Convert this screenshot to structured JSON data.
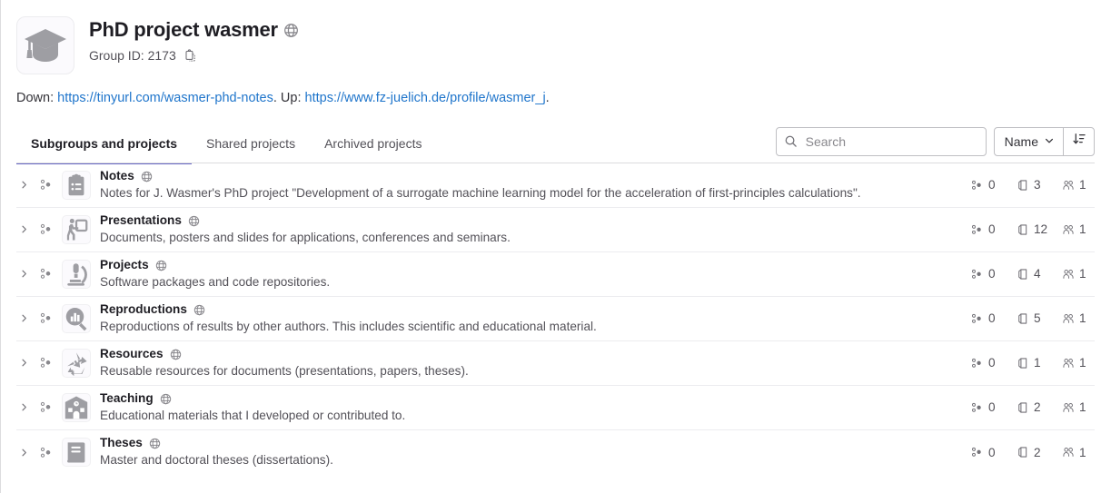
{
  "header": {
    "avatar_icon": "graduation-cap-icon",
    "title": "PhD project wasmer",
    "visibility_icon": "globe-icon",
    "group_id_label": "Group ID: 2173",
    "copy_icon": "clipboard-copy-icon"
  },
  "description": {
    "prefix": "Down: ",
    "link1_text": "https://tinyurl.com/wasmer-phd-notes",
    "middle": ". Up: ",
    "link2_text": "https://www.fz-juelich.de/profile/wasmer_j",
    "suffix": ".",
    "link_color": "#1f75cb"
  },
  "tabs": [
    {
      "label": "Subgroups and projects",
      "active": true
    },
    {
      "label": "Shared projects",
      "active": false
    },
    {
      "label": "Archived projects",
      "active": false
    }
  ],
  "controls": {
    "search_placeholder": "Search",
    "search_value": "",
    "search_icon": "search-icon",
    "sort_label": "Name",
    "sort_chevron_icon": "chevron-down-icon",
    "sort_direction_icon": "sort-descending-icon"
  },
  "accent": {
    "tab_active_underline": "#6666c4",
    "text_primary": "#1f1e24",
    "text_secondary": "#535158",
    "border": "#dcdcde"
  },
  "stat_icons": {
    "subgroups": "subgroup-icon",
    "projects": "project-icon",
    "members": "members-icon"
  },
  "rows": [
    {
      "expand_icon": "chevron-right-icon",
      "type_icon": "subgroup-icon",
      "avatar_icon": "clipboard-notes-icon",
      "title": "Notes",
      "visibility_icon": "globe-icon",
      "description": "Notes for J. Wasmer's PhD project \"Development of a surrogate machine learning model for the acceleration of first-principles calculations\".",
      "subgroups": "0",
      "projects": "3",
      "members": "1"
    },
    {
      "expand_icon": "chevron-right-icon",
      "type_icon": "subgroup-icon",
      "avatar_icon": "presenter-board-icon",
      "title": "Presentations",
      "visibility_icon": "globe-icon",
      "description": "Documents, posters and slides for applications, conferences and seminars.",
      "subgroups": "0",
      "projects": "12",
      "members": "1"
    },
    {
      "expand_icon": "chevron-right-icon",
      "type_icon": "subgroup-icon",
      "avatar_icon": "microscope-icon",
      "title": "Projects",
      "visibility_icon": "globe-icon",
      "description": "Software packages and code repositories.",
      "subgroups": "0",
      "projects": "4",
      "members": "1"
    },
    {
      "expand_icon": "chevron-right-icon",
      "type_icon": "subgroup-icon",
      "avatar_icon": "chart-magnifier-icon",
      "title": "Reproductions",
      "visibility_icon": "globe-icon",
      "description": "Reproductions of results by other authors. This includes scientific and educational material.",
      "subgroups": "0",
      "projects": "5",
      "members": "1"
    },
    {
      "expand_icon": "chevron-right-icon",
      "type_icon": "subgroup-icon",
      "avatar_icon": "recycle-icon",
      "title": "Resources",
      "visibility_icon": "globe-icon",
      "description": "Reusable resources for documents (presentations, papers, theses).",
      "subgroups": "0",
      "projects": "1",
      "members": "1"
    },
    {
      "expand_icon": "chevron-right-icon",
      "type_icon": "subgroup-icon",
      "avatar_icon": "school-building-icon",
      "title": "Teaching",
      "visibility_icon": "globe-icon",
      "description": "Educational materials that I developed or contributed to.",
      "subgroups": "0",
      "projects": "2",
      "members": "1"
    },
    {
      "expand_icon": "chevron-right-icon",
      "type_icon": "subgroup-icon",
      "avatar_icon": "book-icon",
      "title": "Theses",
      "visibility_icon": "globe-icon",
      "description": "Master and doctoral theses (dissertations).",
      "subgroups": "0",
      "projects": "2",
      "members": "1"
    }
  ]
}
